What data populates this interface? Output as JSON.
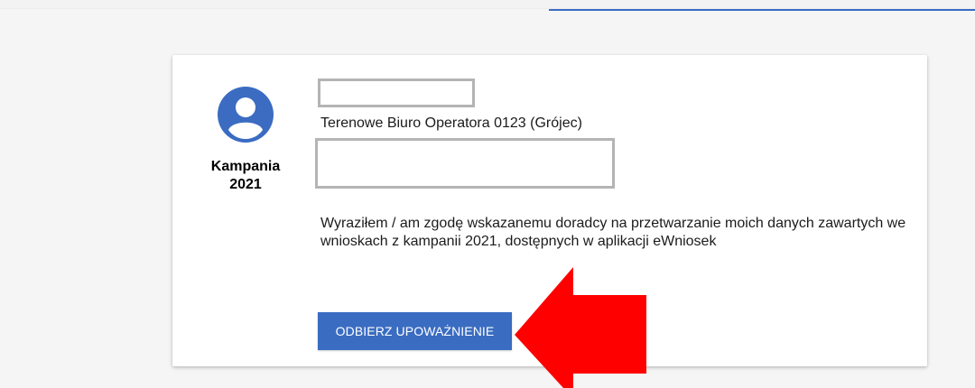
{
  "card": {
    "campaign_label": "Kampania\n2021",
    "operator": "Terenowe Biuro Operatora 0123 (Grójec)",
    "consent_text": "Wyraziłem / am zgodę wskazanemu doradcy na przetwarzanie moich danych zawartych we wnioskach z kampanii 2021, dostępnych w aplikacji eWniosek",
    "revoke_button_label": "ODBIERZ UPOWAŻNIENIE"
  },
  "icons": {
    "avatar": "account-circle-icon",
    "arrow": "red-arrow-annotation"
  },
  "colors": {
    "accent": "#3a6cc1",
    "avatar": "#3b6cc2",
    "arrow": "#ff0000",
    "redaction_border": "#b4b4b4"
  }
}
